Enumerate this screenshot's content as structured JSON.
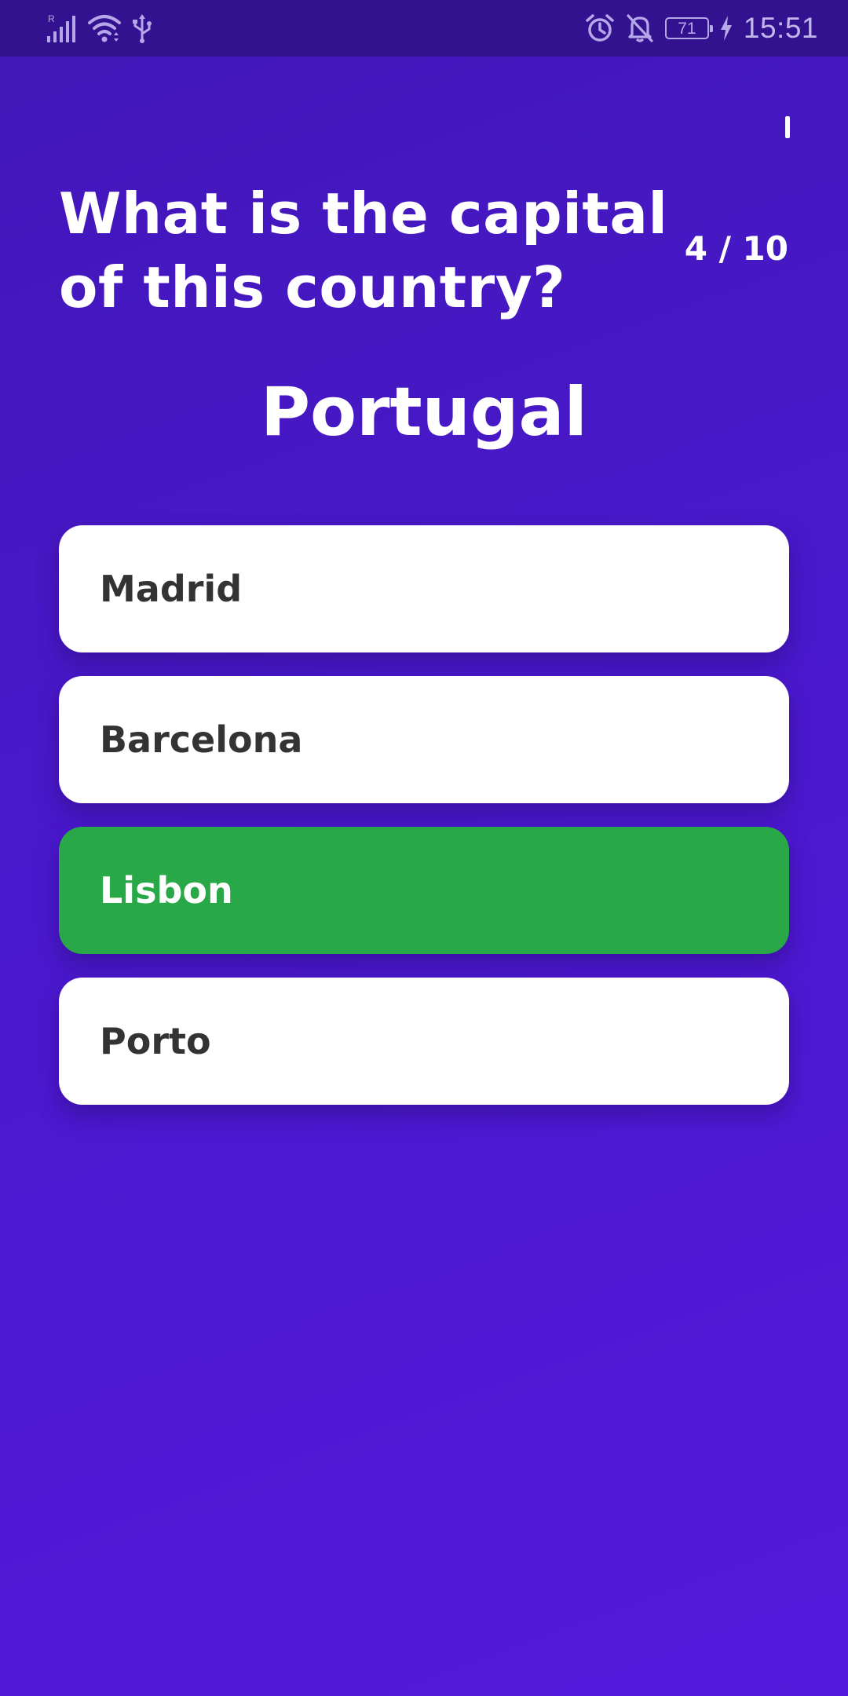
{
  "status_bar": {
    "signal_label": "R",
    "battery_level": "71",
    "time": "15:51",
    "icons": [
      "signal-icon",
      "wifi-icon",
      "usb-icon",
      "alarm-icon",
      "notifications-off-icon",
      "battery-icon",
      "charging-icon"
    ]
  },
  "quiz": {
    "question": "What is the capital of this country?",
    "progress": "4 / 10",
    "country": "Portugal",
    "answers": [
      {
        "label": "Madrid",
        "state": "default"
      },
      {
        "label": "Barcelona",
        "state": "default"
      },
      {
        "label": "Lisbon",
        "state": "correct"
      },
      {
        "label": "Porto",
        "state": "default"
      }
    ]
  },
  "colors": {
    "background_top": "#4117b8",
    "background_bottom": "#5519dd",
    "status_bar": "#33128f",
    "answer_default": "#ffffff",
    "answer_correct": "#28a847",
    "answer_text": "#333333"
  }
}
